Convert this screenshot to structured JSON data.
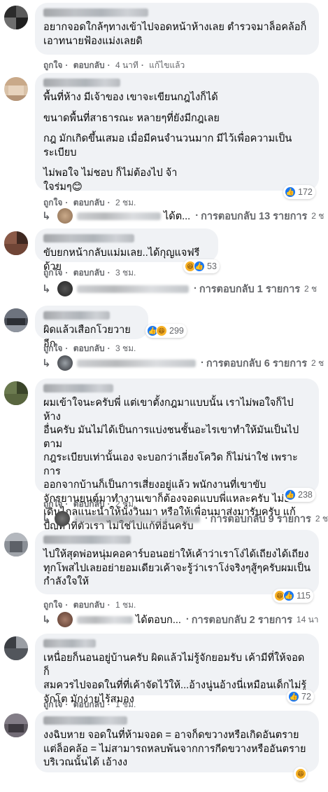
{
  "actions": {
    "like": "ถูกใจ",
    "reply": "ตอบกลับ",
    "dot": "·",
    "edited": "แก้ไขแล้ว"
  },
  "comments": [
    {
      "paras": [
        "อยากจอดใกล้ๆทางเข้าไปจอดหน้าห้างเลย ตำรวจมาล็อคล้อก็\nเอาทนายฟ้องแม่งเลยดิ"
      ],
      "time": "4 นาที"
    },
    {
      "paras": [
        "พื้นที่ห้าง มีเจ้าของ เขาจะเขียนกฎไงก็ได้",
        "ขนาดพื้นที่สาธารณะ หลายๆที่ยังมีกฎเลย",
        "กฎ มักเกิดขึ้นเสมอ เมื่อมีคนจำนวนมาก มีไว้เพื่อความเป็น\nระเบียบ",
        "ไม่พอใจ ไม่ชอบ ก็ไม่ต้องไป จ้า\nใจร่มๆ😊"
      ],
      "time": "2 ชม.",
      "reactions": "172",
      "reply_extra": "ได้ต...",
      "reply_label": "การตอบกลับ 13 รายการ",
      "reply_time": "2 ช"
    },
    {
      "paras": [
        "ขับยกหน้ากลับแม่มเลย..ได้กุญแจฟรีด้วย"
      ],
      "time": "3 ชม.",
      "reactions": "53",
      "reply_label": "การตอบกลับ 1 รายการ",
      "reply_time": "2 ช"
    },
    {
      "paras": [
        "ผิดแล้วเสือกโวยวายอีก"
      ],
      "time": "3 ชม.",
      "reactions": "299",
      "reply_label": "การตอบกลับ 6 รายการ",
      "reply_time": "2 ช"
    },
    {
      "paras": [
        "ผมเข้าใจนะครับพี่ แต่เขาตั้งกฎมาแบบนั้น เราไม่พอใจก็ไปห้าง\nอื่นครับ มันไม่ได้เป็นการแบ่งชนชั้นอะไรเขาทำให้มันเป็นไปตาม\nกฎระเบียบเท่านั้นเอง จะบอกว่าเลี่ยงโควิด ก็ไม่น่าใช่ เพราะการ\nออกจากบ้านก็เป็นการเสี่ยงอยู่แล้ว พนักงานที่เขาขับ\nจักรยานยนต์มาทำงานเขาก็ต้องจอดแบบพี่แหละครับ ไม่อยาก\nเดินไกลแนะนำให้นั่งวินมา หรือให้เพื่อนมาส่งมารับครับ แก้\nปัญหาที่ตัวเรา ไม่ใช่ไปแก้ที่อื่นครับ"
      ],
      "time": "2 ชม.",
      "reactions": "238",
      "reply_label": "การตอบกลับ 9 รายการ",
      "reply_time": "2 ช"
    },
    {
      "paras": [
        "ไปให้สุดพ่อหนุ่มคอคาร์บอนอย่าให้เค้าว่าเราโง่ได้เถียงได้เถียง\nทุกโพสไปเลยอย่ายอมเดียวเค้าจะรู้ว่าเราโง่จริงๆสู้ๆครับผมเป็น\nกำลังใจให้"
      ],
      "time": "1 ชม.",
      "reactions": "115",
      "reply_extra": "ได้ตอบก...",
      "reply_label": "การตอบกลับ 2 รายการ",
      "reply_time": "14 นา"
    },
    {
      "paras": [
        "เหนื่อยก็นอนอยู่บ้านครับ ผิดแล้วไม่รู้จักยอมรับ เค้ามีที่ให้จอดก็\nสมควรไปจอดในที่ที่เค้าจัดไว้ให้...อ้างนู่นอ้างนี่เหมือนเด็กไม่รู้\nจักโต มักง่ายไร้สมอง"
      ],
      "time": "1 ชม.",
      "reactions": "72"
    },
    {
      "paras": [
        "งงฉิบหาย จอดในที่ห้ามจอด = อาจก็ดขวางหรือเกิดอันตราย\nแต่ล็อคล้อ = ไม่สามารถหลบพ้นจากการกีดขวางหรืออันตราย\nบริเวณนั้นได้ เอ้างง"
      ]
    }
  ]
}
